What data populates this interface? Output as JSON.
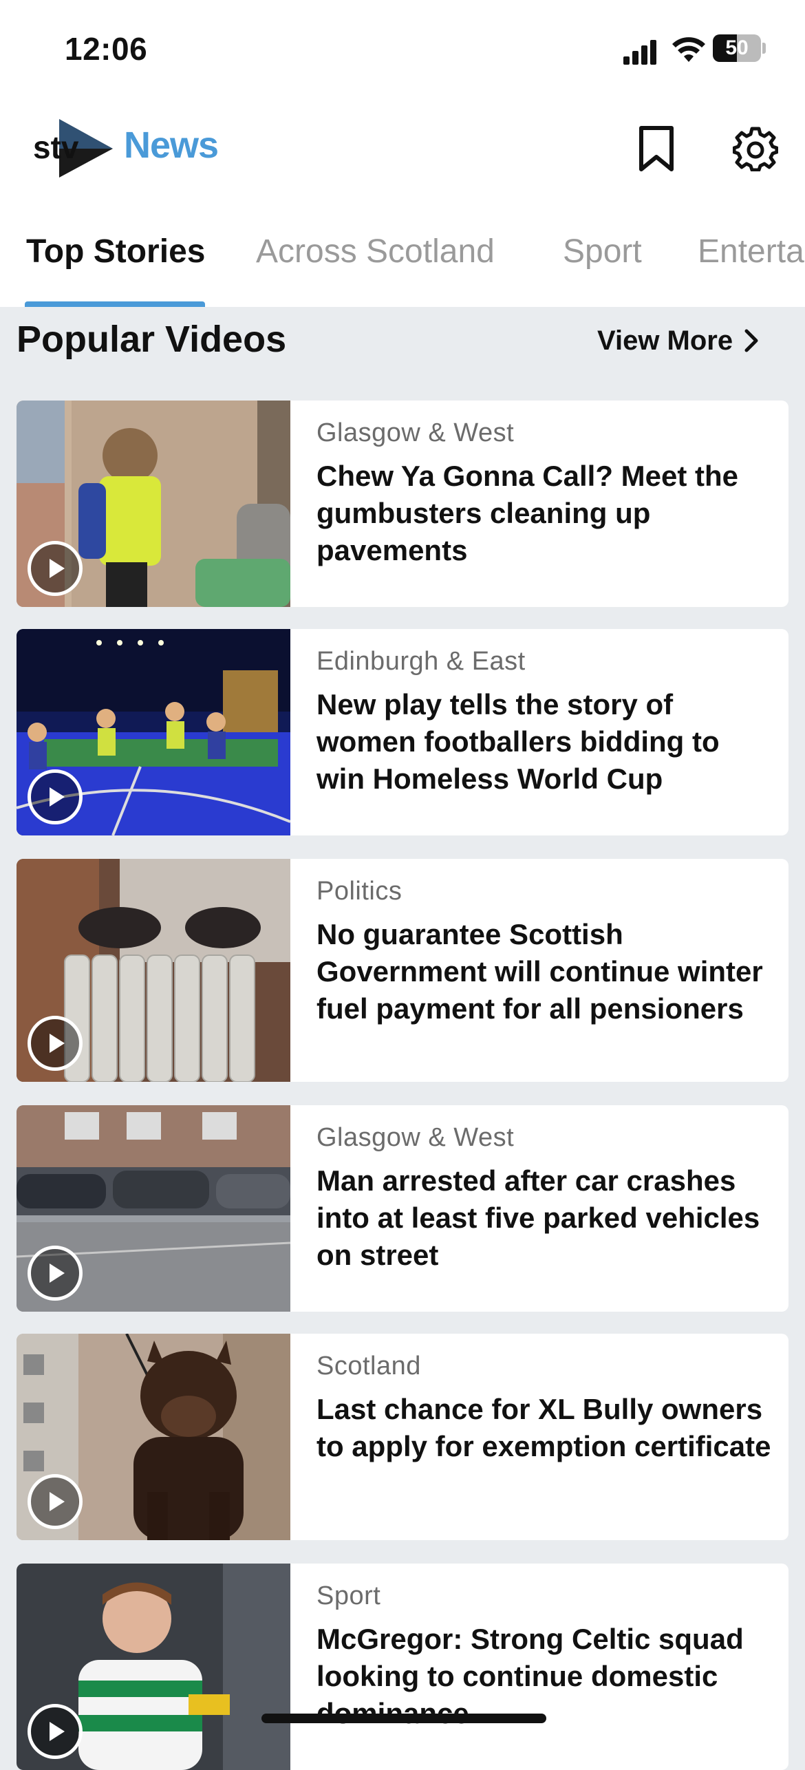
{
  "status_bar": {
    "time": "12:06",
    "battery": "50",
    "battery_level": 0.5
  },
  "header": {
    "logo_news": "News"
  },
  "tabs": [
    {
      "label": "Top Stories"
    },
    {
      "label": "Across Scotland"
    },
    {
      "label": "Sport"
    },
    {
      "label": "Enterta"
    }
  ],
  "section": {
    "title": "Popular Videos",
    "view_more": "View More"
  },
  "stories": [
    {
      "category": "Glasgow & West",
      "headline": "Chew Ya Gonna Call? Meet the gumbusters cleaning up pavements"
    },
    {
      "category": "Edinburgh & East",
      "headline": "New play tells the story of women footballers bidding to win Homeless World Cup"
    },
    {
      "category": "Politics",
      "headline": "No guarantee Scottish Government will continue winter fuel payment for all pensioners"
    },
    {
      "category": "Glasgow & West",
      "headline": "Man arrested after car crashes into at least five parked vehicles on street"
    },
    {
      "category": "Scotland",
      "headline": "Last chance for XL Bully owners to apply for exemption certificate"
    },
    {
      "category": "Sport",
      "headline": "McGregor: Strong Celtic squad looking to continue domestic dominance"
    }
  ],
  "colors": {
    "accent": "#4a9ad8",
    "text": "#111111",
    "category": "#6b6b6b",
    "background": "#e9ecef"
  }
}
